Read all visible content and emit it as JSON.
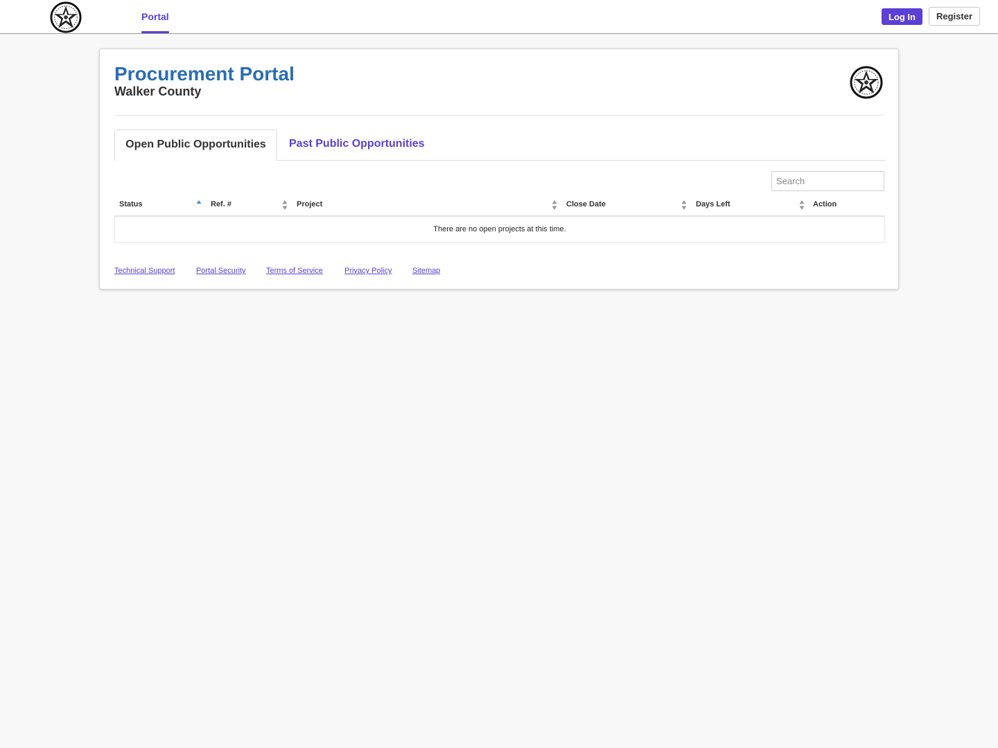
{
  "nav": {
    "logo_icon": "county-seal-icon",
    "portal_label": "Portal",
    "login_label": "Log In",
    "register_label": "Register"
  },
  "header": {
    "title": "Procurement Portal",
    "subtitle": "Walker County"
  },
  "tabs": [
    {
      "label": "Open Public Opportunities",
      "active": true
    },
    {
      "label": "Past Public Opportunities",
      "active": false
    }
  ],
  "search": {
    "placeholder": "Search",
    "value": ""
  },
  "table": {
    "columns": [
      "Status",
      "Ref. #",
      "Project",
      "Close Date",
      "Days Left",
      "Action"
    ],
    "sorted_column": "Status",
    "sort_direction": "ascending",
    "empty_message": "There are no open projects at this time."
  },
  "footer": {
    "links": [
      "Technical Support",
      "Portal Security",
      "Terms of Service",
      "Privacy Policy",
      "Sitemap"
    ]
  },
  "colors": {
    "accent": "#5b3fd6",
    "title": "#2a6db4",
    "sort_active": "#4a90c8"
  }
}
